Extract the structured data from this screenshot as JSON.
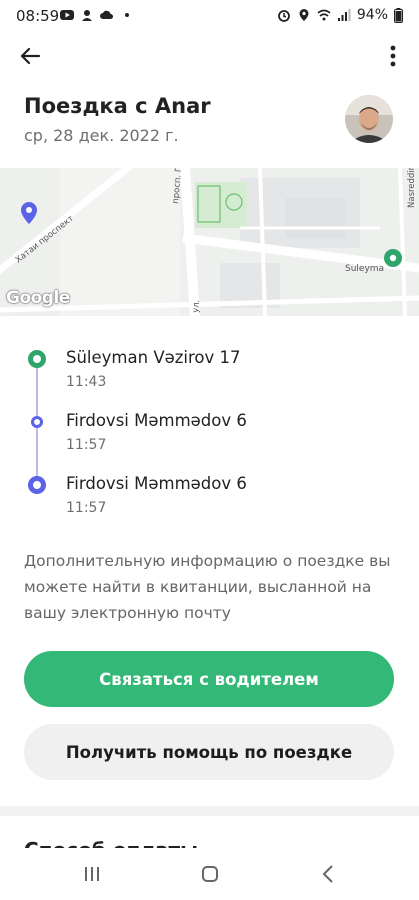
{
  "status_bar": {
    "time": "08:59",
    "battery": "94%"
  },
  "trip": {
    "title": "Поездка с Anar",
    "date": "ср, 28 дек. 2022 г."
  },
  "map": {
    "google_label": "Google",
    "labels": [
      "Хатаи проспект",
      "просп. Гейд.",
      "Suleyma",
      "ул.",
      "Nasreddin"
    ]
  },
  "route": {
    "stops": [
      {
        "address": "Süleyman Vəzirov 17",
        "time": "11:43"
      },
      {
        "address": "Firdovsi Məmmədov 6",
        "time": "11:57"
      },
      {
        "address": "Firdovsi Məmmədov 6",
        "time": "11:57"
      }
    ]
  },
  "info_text": "Дополнительную информацию о поездке вы можете найти в квитанции, высланной на вашу электронную почту",
  "buttons": {
    "contact_driver": "Связаться с водителем",
    "get_help": "Получить помощь по поездке"
  },
  "payment": {
    "heading": "Способ оплаты"
  },
  "colors": {
    "accent_green": "#33b877",
    "route_purple": "#5b63e6",
    "start_green": "#2ea56a"
  }
}
